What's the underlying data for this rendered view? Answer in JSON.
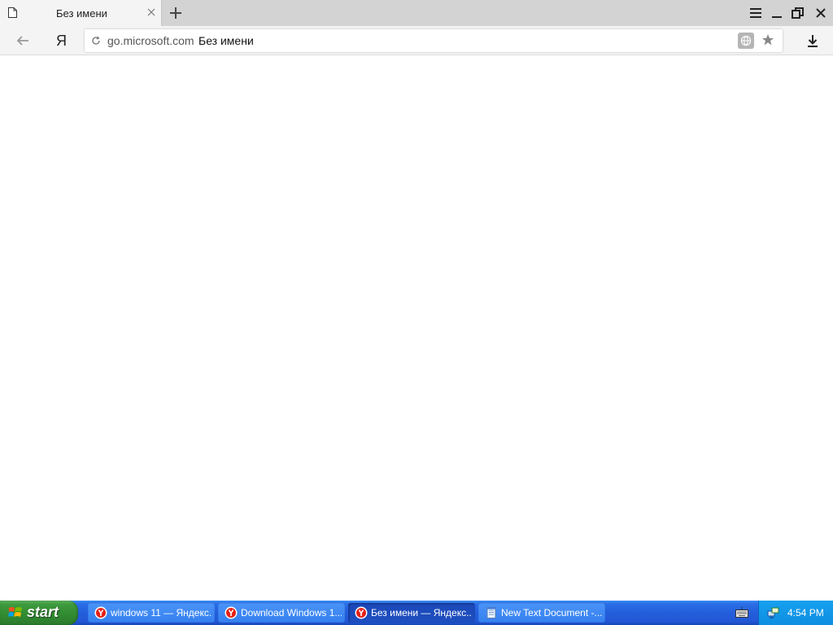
{
  "browser": {
    "tab": {
      "title": "Без имени"
    },
    "address_bar": {
      "domain": "go.microsoft.com",
      "page_title": "Без имени"
    },
    "logo": "Я"
  },
  "taskbar": {
    "start_label": "start",
    "tasks": [
      {
        "label": "windows 11 — Яндекс...",
        "icon": "yandex-browser-icon",
        "active": false
      },
      {
        "label": "Download Windows 1...",
        "icon": "yandex-browser-icon",
        "active": false
      },
      {
        "label": "Без имени — Яндекс...",
        "icon": "yandex-browser-icon",
        "active": true
      },
      {
        "label": "New Text Document -...",
        "icon": "notepad-icon",
        "active": false
      }
    ],
    "clock": "4:54 PM"
  },
  "colors": {
    "taskbar": "#245edb",
    "start": "#3e9a3e",
    "tray": "#0e8ee0",
    "yandex_red": "#e62117"
  }
}
